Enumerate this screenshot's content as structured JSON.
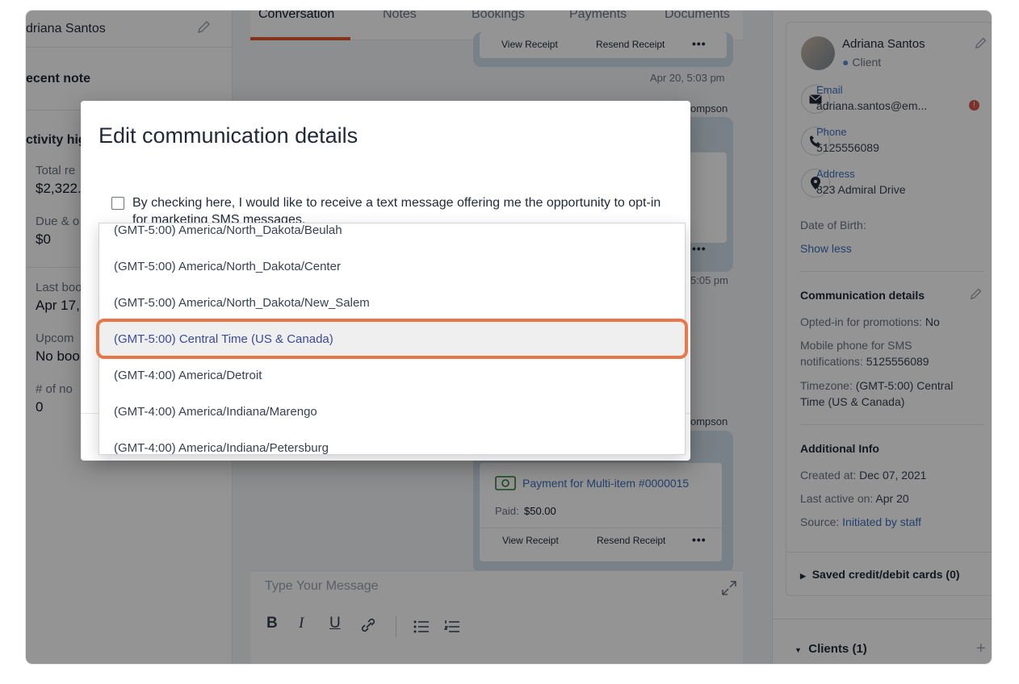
{
  "left_panel": {
    "name": "driana Santos",
    "recent_note": "ecent note",
    "activity": "ctivity hig",
    "total_label": "Total re",
    "total_value": "$2,322.",
    "due_label": "Due & o",
    "due_value": "$0",
    "last_booking_label": "Last boo",
    "last_booking_value": "Apr 17,",
    "upcoming_label": "Upcom",
    "upcoming_value": "No boo",
    "no_show_label": "# of no",
    "no_show_value": "0"
  },
  "tabs": [
    "Conversation",
    "Notes",
    "Bookings",
    "Payments",
    "Documents"
  ],
  "chat": {
    "view_receipt": "View Receipt",
    "resend_receipt": "Resend Receipt",
    "more": "•••",
    "ts1": "Apr 20, 5:03 pm",
    "ts_partial": "5:05 pm",
    "sender_partial1": "ompson",
    "sender_partial2": "ompson",
    "payment_title": "Payment for Multi-item #0000015",
    "paid_label": "Paid:",
    "paid_value": "$50.00"
  },
  "composer": {
    "placeholder": "Type Your Message",
    "format_buttons": [
      "B",
      "I",
      "U",
      "link",
      "bullets",
      "numbers"
    ]
  },
  "right_panel": {
    "client_name": "Adriana Santos",
    "client_role": "Client",
    "email_label": "Email",
    "email_value": "adriana.santos@em...",
    "phone_label": "Phone",
    "phone_value": "5125556089",
    "address_label": "Address",
    "address_value": "823 Admiral Drive",
    "dob_label": "Date of Birth:",
    "show_less": "Show less",
    "comm_title": "Communication details",
    "opted_label": "Opted-in for promotions:",
    "opted_value": "No",
    "sms_label": "Mobile phone for SMS",
    "sms_label2": "notifications:",
    "sms_value": "5125556089",
    "tz_label": "Timezone:",
    "tz_value1": "(GMT-5:00) Central",
    "tz_value2": "Time (US & Canada)",
    "additional_title": "Additional Info",
    "created_label": "Created at:",
    "created_value": "Dec 07, 2021",
    "last_active_label": "Last active on:",
    "last_active_value": "Apr 20",
    "source_label": "Source:",
    "source_value": "Initiated by staff",
    "saved_cards": "Saved credit/debit cards (0)",
    "clients": "Clients (1)"
  },
  "modal": {
    "title": "Edit communication details",
    "consent_text": "By checking here, I would like to receive a text message offering me the opportunity to opt-in for marketing SMS messages.",
    "consent_checked": false
  },
  "timezone_dropdown": {
    "options": [
      "(GMT-5:00) America/North_Dakota/Beulah",
      "(GMT-5:00) America/North_Dakota/Center",
      "(GMT-5:00) America/North_Dakota/New_Salem",
      "(GMT-5:00) Central Time (US & Canada)",
      "(GMT-4:00) America/Detroit",
      "(GMT-4:00) America/Indiana/Marengo",
      "(GMT-4:00) America/Indiana/Petersburg"
    ],
    "selected": "(GMT-5:00) Central Time (US & Canada)"
  },
  "colors": {
    "accent": "#e4572e",
    "highlight": "#e8784a",
    "link": "#3b6fc0",
    "selected_text": "#3b4a9e"
  }
}
